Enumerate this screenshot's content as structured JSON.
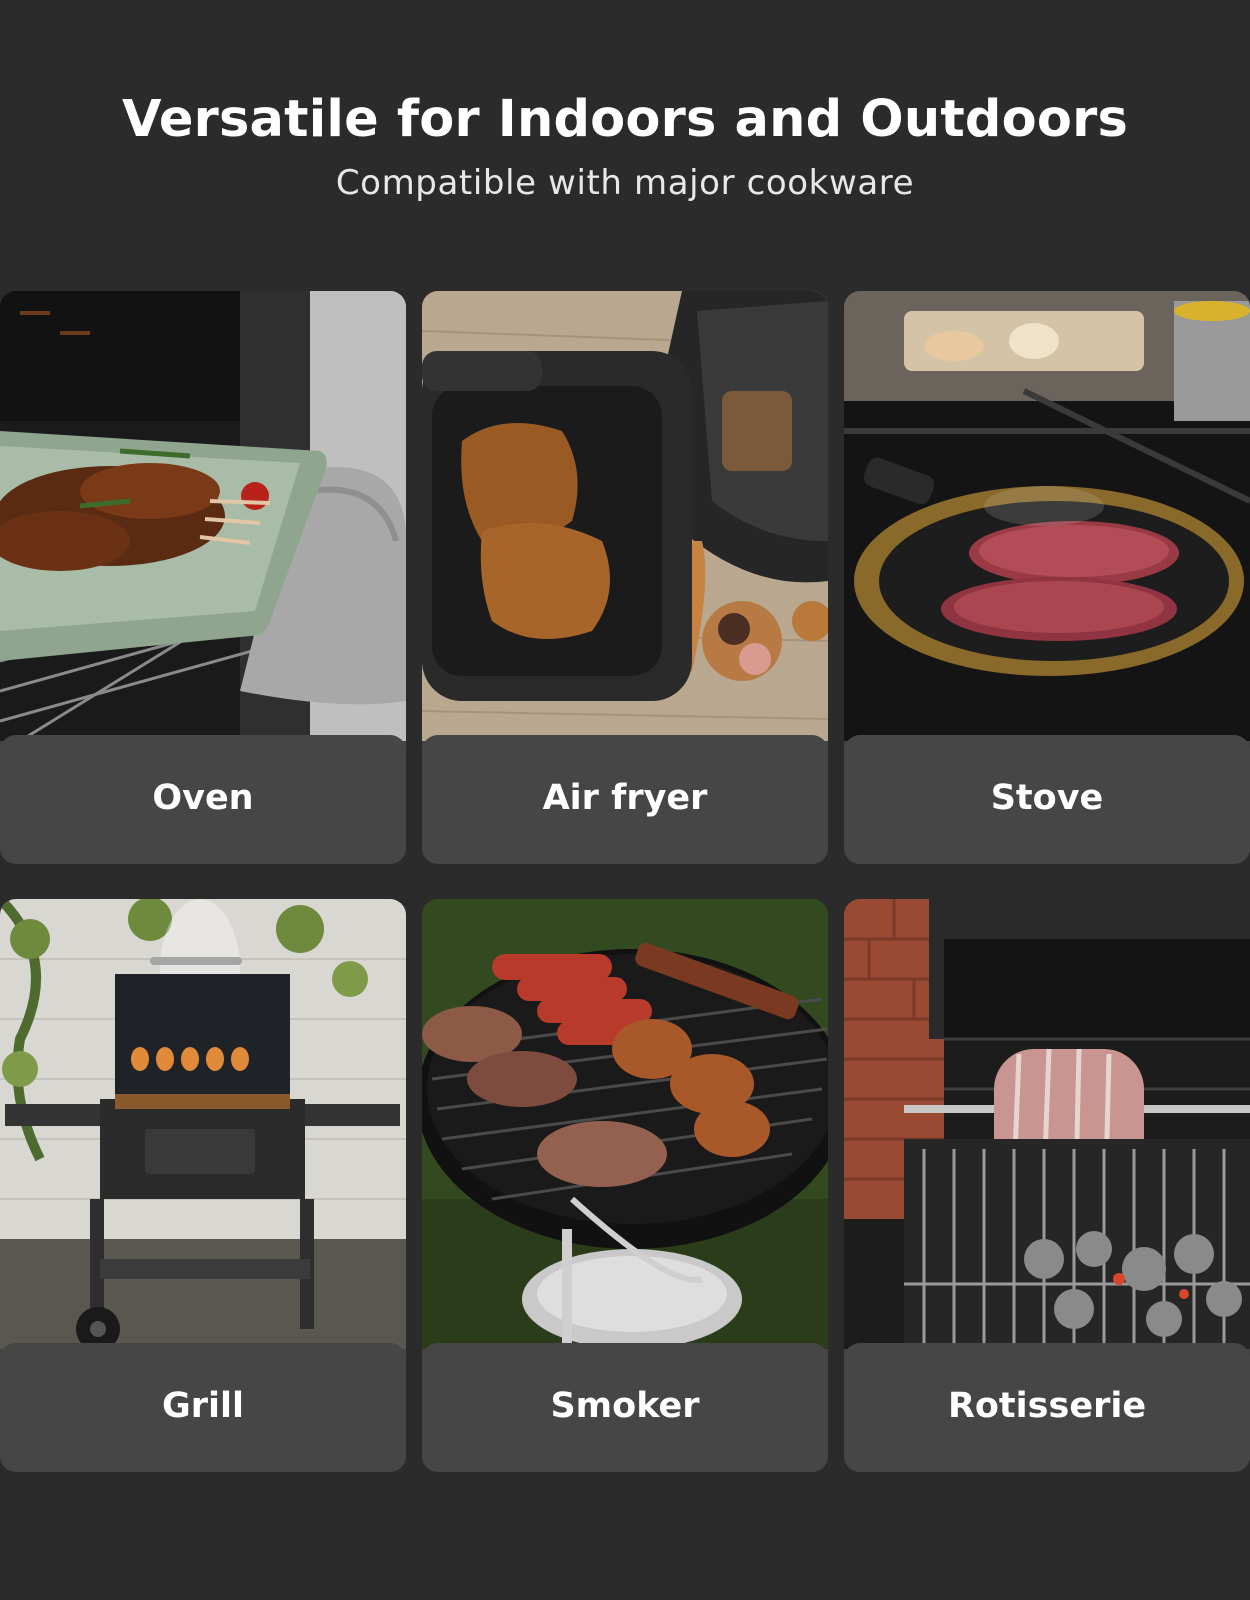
{
  "header": {
    "title": "Versatile for Indoors and Outdoors",
    "subtitle": "Compatible with major cookware"
  },
  "cards": [
    {
      "label": "Oven",
      "image": "roast-in-oven-photo"
    },
    {
      "label": "Air fryer",
      "image": "air-fryer-basket-photo"
    },
    {
      "label": "Stove",
      "image": "steak-in-pan-photo"
    },
    {
      "label": "Grill",
      "image": "barrel-grill-photo"
    },
    {
      "label": "Smoker",
      "image": "kettle-grill-photo"
    },
    {
      "label": "Rotisserie",
      "image": "rotisserie-spit-photo"
    }
  ],
  "colors": {
    "background": "#2b2b2b",
    "label_bar": "#464646",
    "text": "#ffffff"
  }
}
